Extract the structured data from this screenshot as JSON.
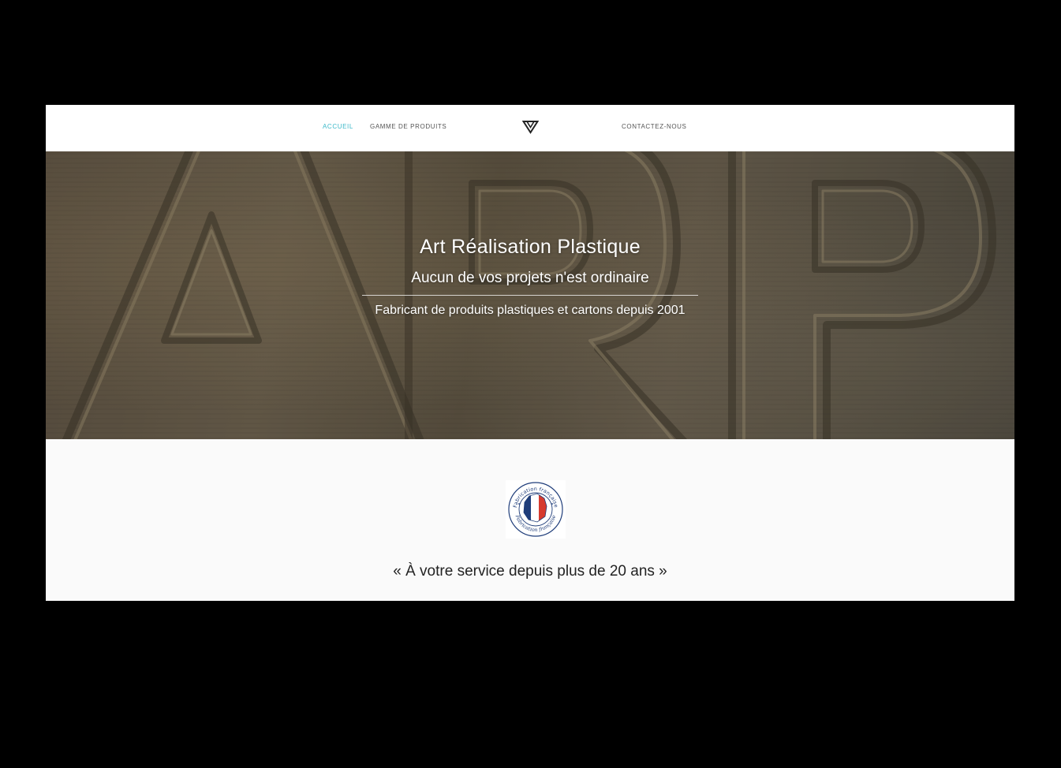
{
  "nav": {
    "items": [
      {
        "label": "ACCUEIL",
        "active": true
      },
      {
        "label": "GAMME DE PRODUITS",
        "active": false
      },
      {
        "label": "CONTACTEZ-NOUS",
        "active": false
      }
    ],
    "logo_icon": "triangle-logo-icon"
  },
  "hero": {
    "background_letters": "ARP",
    "title": "Art Réalisation Plastique",
    "subtitle": "Aucun de vos projets n'est ordinaire",
    "tagline": "Fabricant de produits plastiques et cartons depuis 2001"
  },
  "badge": {
    "text_top": "Fabrication française",
    "text_bottom": "Fabrication française",
    "icon": "france-flag-map-icon"
  },
  "quote": "« À votre service depuis plus de 20 ans »",
  "colors": {
    "accent": "#3bb9c9",
    "page_background": "#000000",
    "content_background": "#fafafa",
    "flag_blue": "#1f3d7a",
    "flag_red": "#d63a2e"
  }
}
